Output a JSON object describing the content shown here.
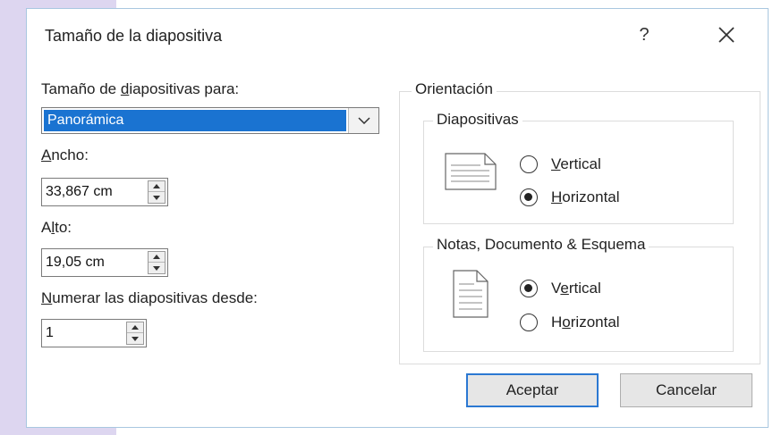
{
  "dialog": {
    "title": "Tamaño de la diapositiva",
    "help_label": "?",
    "close_label": "close"
  },
  "left": {
    "size_for": {
      "pre": "Tamaño de ",
      "accel": "d",
      "post": "iapositivas para:"
    },
    "size_value": "Panorámica",
    "width": {
      "accel": "A",
      "post": "ncho:",
      "value": "33,867 cm"
    },
    "height": {
      "pre": "A",
      "accel": "l",
      "post": "to:",
      "value": "19,05 cm"
    },
    "number_from": {
      "accel": "N",
      "post": "umerar las diapositivas desde:",
      "value": "1"
    }
  },
  "orientation": {
    "legend": "Orientación",
    "slides": {
      "legend": "Diapositivas",
      "vertical": {
        "accel": "V",
        "post": "ertical",
        "selected": false
      },
      "horizontal": {
        "accel": "H",
        "post": "orizontal",
        "selected": true
      }
    },
    "notes": {
      "legend": "Notas, Documento & Esquema",
      "vertical": {
        "pre": "V",
        "accel": "e",
        "post": "rtical",
        "selected": true
      },
      "horizontal": {
        "pre": "H",
        "accel": "o",
        "post": "rizontal",
        "selected": false
      }
    }
  },
  "buttons": {
    "ok": "Aceptar",
    "cancel": "Cancelar"
  },
  "colors": {
    "selection": "#1a73d1",
    "default_button_border": "#2b78d2",
    "background_left": "#ddd6f0"
  }
}
